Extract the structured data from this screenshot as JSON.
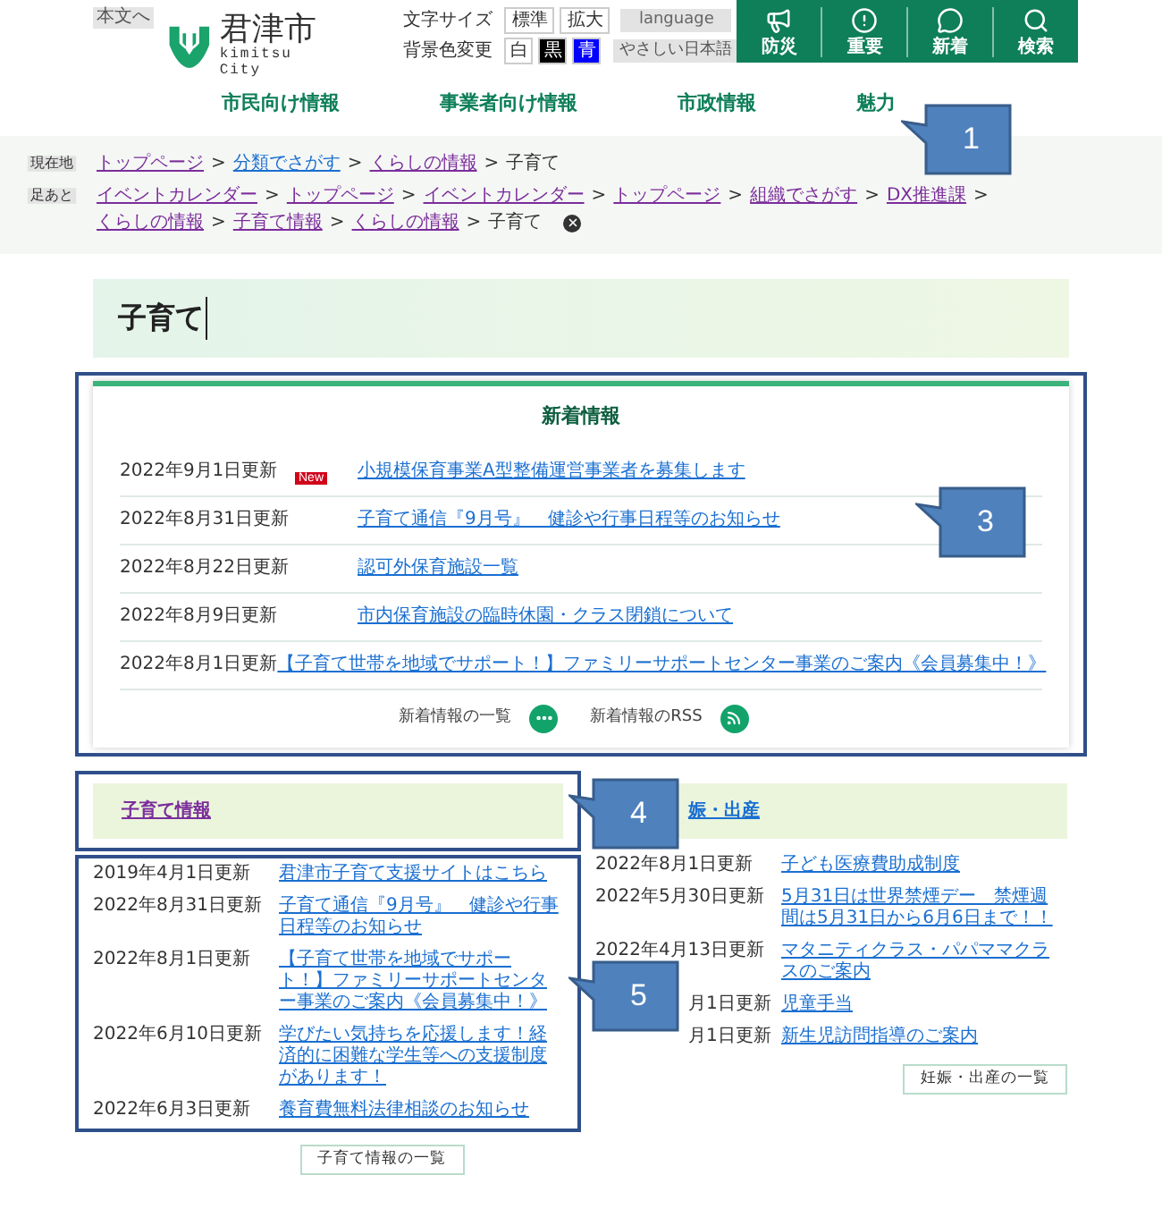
{
  "header": {
    "skip_link": "本文へ",
    "logo": {
      "name": "君津市",
      "roman": "kimitsu City"
    },
    "font_size": {
      "label": "文字サイズ",
      "buttons": [
        "標準",
        "拡大"
      ]
    },
    "language": "language",
    "background": {
      "label": "背景色変更",
      "options": [
        {
          "label": "白",
          "color": "#ffffff"
        },
        {
          "label": "黒",
          "color": "#000000"
        },
        {
          "label": "青",
          "color": "#0000ff"
        }
      ]
    },
    "easy_japanese": "やさしい日本語",
    "quick_links": [
      {
        "kind": "megaphone",
        "label": "防災"
      },
      {
        "kind": "alert",
        "label": "重要"
      },
      {
        "kind": "chat",
        "label": "新着"
      },
      {
        "kind": "search",
        "label": "検索"
      }
    ]
  },
  "nav": [
    "市民向け情報",
    "事業者向け情報",
    "市政情報",
    "魅力"
  ],
  "breadcrumbs": [
    {
      "label": "現在地",
      "separator": ">",
      "items": [
        {
          "text": "トップページ",
          "visited": true
        },
        {
          "text": "分類でさがす",
          "visited": false
        },
        {
          "text": "くらしの情報",
          "visited": true
        },
        {
          "text": "子育て",
          "kind": "current"
        }
      ]
    },
    {
      "label": "足あと",
      "separator": ">",
      "items": [
        {
          "text": "イベントカレンダー",
          "visited": true
        },
        {
          "text": "トップページ",
          "visited": true
        },
        {
          "text": "イベントカレンダー",
          "visited": true
        },
        {
          "text": "トップページ",
          "visited": true
        },
        {
          "text": "組織でさがす",
          "visited": true
        },
        {
          "text": "DX推進課",
          "visited": true
        },
        {
          "text": "くらしの情報",
          "visited": true
        },
        {
          "text": "子育て情報",
          "visited": true
        },
        {
          "text": "くらしの情報",
          "visited": true
        },
        {
          "text": "子育て",
          "kind": "current"
        }
      ],
      "clearable": true
    }
  ],
  "page_title": "子育て",
  "news": {
    "title": "新着情報",
    "items": [
      {
        "date": "2022年9月1日更新",
        "badge": "New",
        "link": "小規模保育事業A型整備運営事業者を募集します"
      },
      {
        "date": "2022年8月31日更新",
        "link": "子育て通信『9月号』　健診や行事日程等のお知らせ"
      },
      {
        "date": "2022年8月22日更新",
        "link": "認可外保育施設一覧"
      },
      {
        "date": "2022年8月9日更新",
        "link": "市内保育施設の臨時休園・クラス閉鎖について"
      },
      {
        "date": "2022年8月1日更新",
        "link": "【子育て世帯を地域でサポート！】ファミリーサポートセンター事業のご案内《会員募集中！》"
      }
    ],
    "footer": [
      {
        "kind": "more",
        "text": "新着情報の一覧"
      },
      {
        "kind": "rss",
        "text": "新着情報のRSS"
      }
    ]
  },
  "sections": [
    {
      "title": "子育て情報",
      "visited": true,
      "items": [
        {
          "date": "2019年4月1日更新",
          "link": "君津市子育て支援サイトはこちら"
        },
        {
          "date": "2022年8月31日更新",
          "link": "子育て通信『9月号』　健診や行事日程等のお知らせ"
        },
        {
          "date": "2022年8月1日更新",
          "link": "【子育て世帯を地域でサポート！】ファミリーサポートセンター事業のご案内《会員募集中！》"
        },
        {
          "date": "2022年6月10日更新",
          "link": "学びたい気持ちを応援します！経済的に困難な学生等への支援制度があります！"
        },
        {
          "date": "2022年6月3日更新",
          "link": "養育費無料法律相談のお知らせ"
        }
      ],
      "more": "子育て情報の一覧"
    },
    {
      "title": "娠・出産",
      "visited": false,
      "items": [
        {
          "date": "2022年8月1日更新",
          "link": "子ども医療費助成制度"
        },
        {
          "date": "2022年5月30日更新",
          "link": "5月31日は世界禁煙デー　禁煙週間は5月31日から6月6日まで！！"
        },
        {
          "date": "2022年4月13日更新",
          "link": "マタニティクラス・パパママクラスのご案内"
        },
        {
          "date": "月1日更新",
          "link": "児童手当"
        },
        {
          "date": "月1日更新",
          "link": "新生児訪問指導のご案内"
        }
      ],
      "more": "妊娠・出産の一覧"
    }
  ],
  "annotations": [
    {
      "label": "1"
    },
    {
      "label": "3"
    },
    {
      "label": "4"
    },
    {
      "label": "5"
    }
  ]
}
